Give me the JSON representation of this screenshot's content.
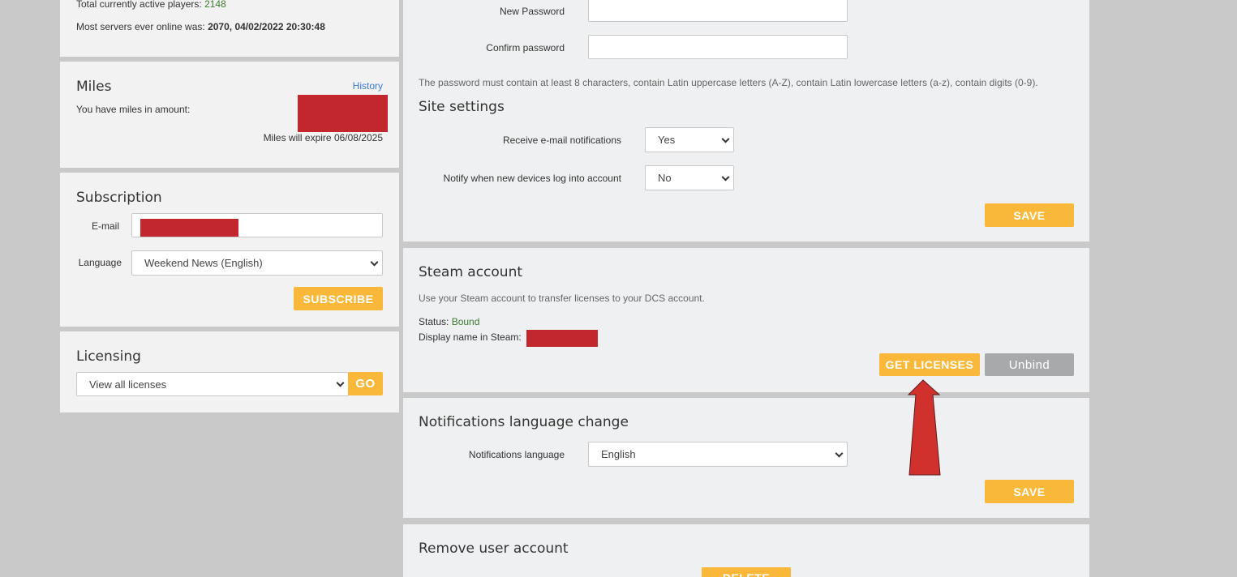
{
  "stats": {
    "active_players_label": "Total currently active players:",
    "active_players_value": "2148",
    "most_servers_label": "Most servers ever online was:",
    "most_servers_value": "2070, 04/02/2022 20:30:48"
  },
  "miles": {
    "title": "Miles",
    "history_link": "History",
    "amount_label": "You have miles in amount:",
    "expire_label": "Miles will expire",
    "expire_date": "06/08/2025"
  },
  "subscription": {
    "title": "Subscription",
    "email_label": "E-mail",
    "language_label": "Language",
    "language_value": "Weekend News (English)",
    "subscribe_button": "SUBSCRIBE"
  },
  "licensing": {
    "title": "Licensing",
    "select_value": "View all licenses",
    "go_button": "GO"
  },
  "password": {
    "new_password_label": "New Password",
    "confirm_label": "Confirm password",
    "hint": "The password must contain at least 8 characters, contain Latin uppercase letters (A-Z), contain Latin lowercase letters (a-z), contain digits (0-9)."
  },
  "site_settings": {
    "title": "Site settings",
    "email_notif_label": "Receive e-mail notifications",
    "email_notif_value": "Yes",
    "devices_notif_label": "Notify when new devices log into account",
    "devices_notif_value": "No",
    "save_button": "SAVE"
  },
  "steam": {
    "title": "Steam account",
    "description": "Use your Steam account to transfer licenses to your DCS account.",
    "status_label": "Status:",
    "status_value": "Bound",
    "display_name_label": "Display name in Steam:",
    "get_licenses_button": "GET LICENSES",
    "unbind_button": "Unbind"
  },
  "notif_language": {
    "title": "Notifications language change",
    "label": "Notifications language",
    "value": "English",
    "save_button": "SAVE"
  },
  "remove_account": {
    "title": "Remove user account",
    "delete_button": "DELETE"
  },
  "colors": {
    "accent": "#f9b83a",
    "redaction": "#c1272d",
    "status_green": "#3c7a2e",
    "arrow": "#d0312d"
  }
}
